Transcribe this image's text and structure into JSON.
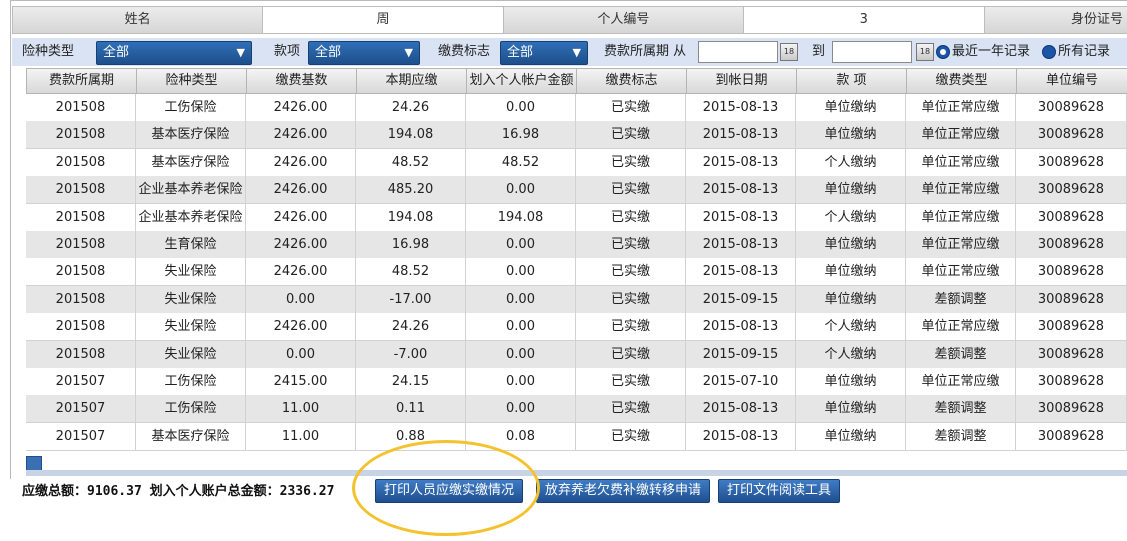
{
  "info": {
    "name_label": "姓名",
    "name_value": "周",
    "id_label": "个人编号",
    "id_value": "3",
    "idcard_label": "身份证号"
  },
  "filter": {
    "type_label": "险种类型",
    "type_value": "全部",
    "item_label": "款项",
    "item_value": "全部",
    "flag_label": "缴费标志",
    "flag_value": "全部",
    "period_label": "费款所属期 从",
    "to_label": "到",
    "calendar_icon_text": "18",
    "radio_recent": "最近一年记录",
    "radio_all": "所有记录"
  },
  "table": {
    "headers": [
      "费款所属期",
      "险种类型",
      "缴费基数",
      "本期应缴",
      "划入个人帐户金额",
      "缴费标志",
      "到帐日期",
      "款 项",
      "缴费类型",
      "单位编号"
    ],
    "rows": [
      [
        "201508",
        "工伤保险",
        "2426.00",
        "24.26",
        "0.00",
        "已实缴",
        "2015-08-13",
        "单位缴纳",
        "单位正常应缴",
        "30089628"
      ],
      [
        "201508",
        "基本医疗保险",
        "2426.00",
        "194.08",
        "16.98",
        "已实缴",
        "2015-08-13",
        "单位缴纳",
        "单位正常应缴",
        "30089628"
      ],
      [
        "201508",
        "基本医疗保险",
        "2426.00",
        "48.52",
        "48.52",
        "已实缴",
        "2015-08-13",
        "个人缴纳",
        "单位正常应缴",
        "30089628"
      ],
      [
        "201508",
        "企业基本养老保险",
        "2426.00",
        "485.20",
        "0.00",
        "已实缴",
        "2015-08-13",
        "单位缴纳",
        "单位正常应缴",
        "30089628"
      ],
      [
        "201508",
        "企业基本养老保险",
        "2426.00",
        "194.08",
        "194.08",
        "已实缴",
        "2015-08-13",
        "个人缴纳",
        "单位正常应缴",
        "30089628"
      ],
      [
        "201508",
        "生育保险",
        "2426.00",
        "16.98",
        "0.00",
        "已实缴",
        "2015-08-13",
        "单位缴纳",
        "单位正常应缴",
        "30089628"
      ],
      [
        "201508",
        "失业保险",
        "2426.00",
        "48.52",
        "0.00",
        "已实缴",
        "2015-08-13",
        "单位缴纳",
        "单位正常应缴",
        "30089628"
      ],
      [
        "201508",
        "失业保险",
        "0.00",
        "-17.00",
        "0.00",
        "已实缴",
        "2015-09-15",
        "单位缴纳",
        "差额调整",
        "30089628"
      ],
      [
        "201508",
        "失业保险",
        "2426.00",
        "24.26",
        "0.00",
        "已实缴",
        "2015-08-13",
        "个人缴纳",
        "单位正常应缴",
        "30089628"
      ],
      [
        "201508",
        "失业保险",
        "0.00",
        "-7.00",
        "0.00",
        "已实缴",
        "2015-09-15",
        "个人缴纳",
        "差额调整",
        "30089628"
      ],
      [
        "201507",
        "工伤保险",
        "2415.00",
        "24.15",
        "0.00",
        "已实缴",
        "2015-07-10",
        "单位缴纳",
        "单位正常应缴",
        "30089628"
      ],
      [
        "201507",
        "工伤保险",
        "11.00",
        "0.11",
        "0.00",
        "已实缴",
        "2015-08-13",
        "单位缴纳",
        "差额调整",
        "30089628"
      ],
      [
        "201507",
        "基本医疗保险",
        "11.00",
        "0.88",
        "0.08",
        "已实缴",
        "2015-08-13",
        "单位缴纳",
        "差额调整",
        "30089628"
      ]
    ]
  },
  "summary": {
    "text": "应缴总额：9106.37 划入个人账户总金额：2336.27"
  },
  "buttons": {
    "print_status": "打印人员应缴实缴情况",
    "waive": "放弃养老欠费补缴转移申请",
    "print_tool": "打印文件阅读工具"
  },
  "colors": {
    "select_blue": "#1e4f8a",
    "filter_bg": "#d9e3f3",
    "highlight_circle": "#f4c22c"
  }
}
